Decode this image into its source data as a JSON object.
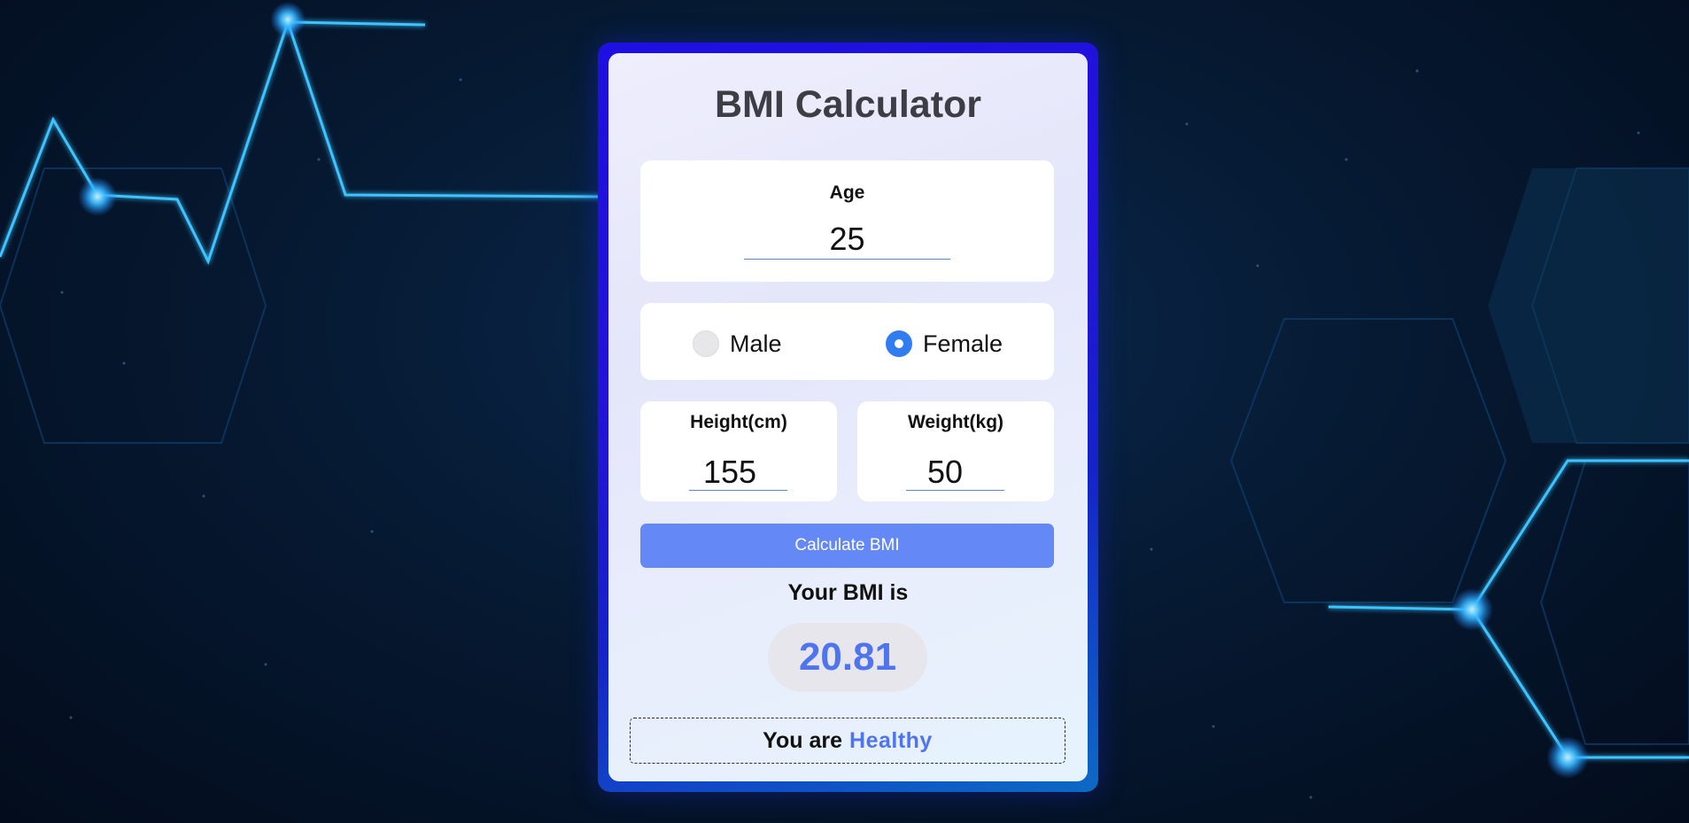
{
  "app": {
    "title": "BMI Calculator"
  },
  "age": {
    "label": "Age",
    "value": "25"
  },
  "gender": {
    "options": [
      {
        "label": "Male",
        "selected": false
      },
      {
        "label": "Female",
        "selected": true
      }
    ]
  },
  "height": {
    "label": "Height(cm)",
    "value": "155"
  },
  "weight": {
    "label": "Weight(kg)",
    "value": "50"
  },
  "actions": {
    "calculate_label": "Calculate BMI"
  },
  "result": {
    "label": "Your BMI is",
    "value": "20.81",
    "status_prefix": "You are",
    "status": "Healthy"
  },
  "colors": {
    "accent": "#6488f6",
    "bmi_text": "#4f74ee",
    "radio_selected": "#2f7df0"
  }
}
